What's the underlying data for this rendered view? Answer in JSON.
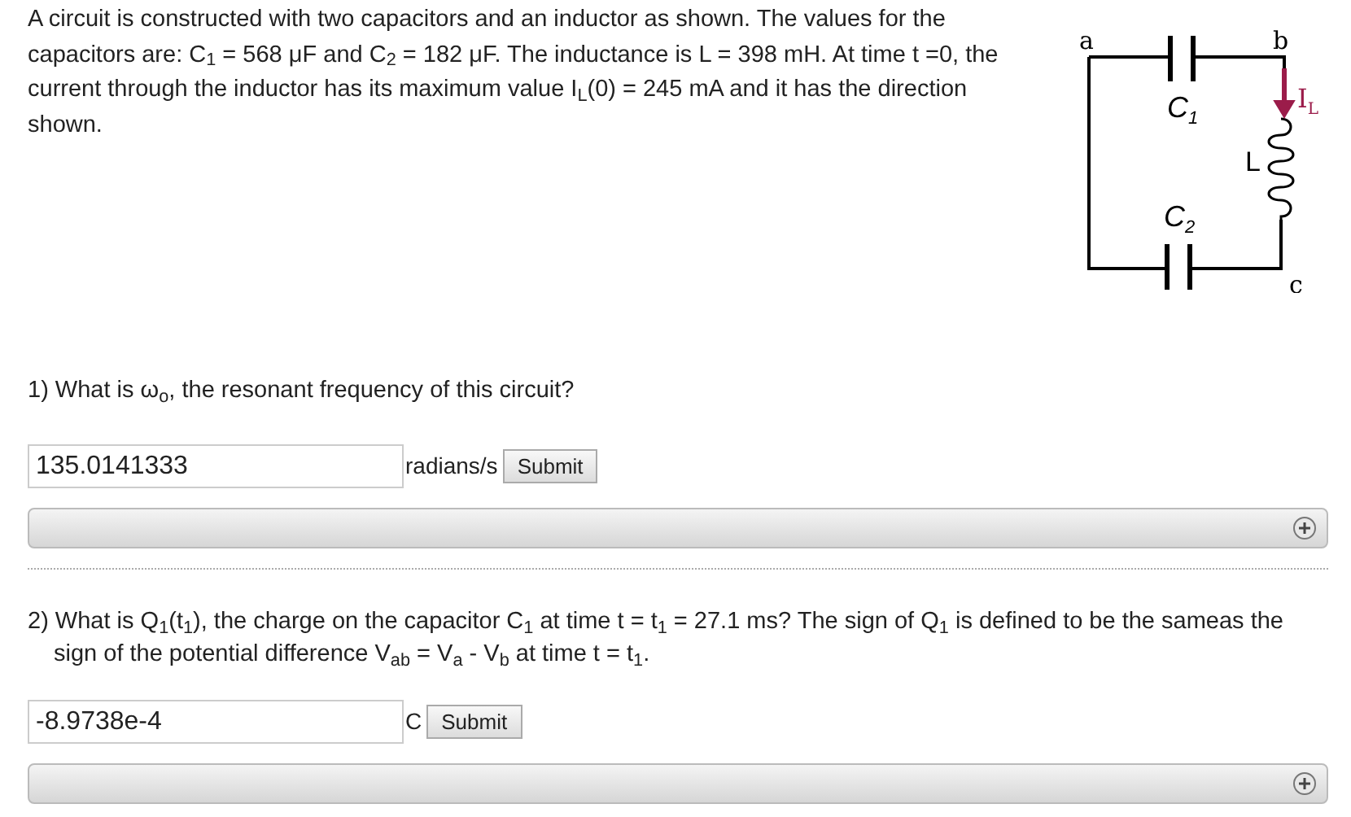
{
  "intro": "A circuit is constructed with two capacitors and an inductor as shown. The values for the capacitors are: C$_{1}$ = 568 μF and C$_{2}$ = 182 μF. The inductance is L = 398 mH. At time t =0, the current through the inductor has its maximum value I$_{L}$(0) = 245 mA and it has the direction shown.",
  "diagram": {
    "node_a": "a",
    "node_b": "b",
    "node_c": "c",
    "c1": "C",
    "c1_sub": "1",
    "c2": "C",
    "c2_sub": "2",
    "inductor": "L",
    "current": "I",
    "current_sub": "L"
  },
  "questions": [
    {
      "number": "1)",
      "text": "What is ω$_{o}$, the resonant frequency of this circuit?",
      "value": "135.0141333",
      "unit": "radians/s",
      "button": "Submit",
      "expanded": false
    },
    {
      "number": "2)",
      "text": "What is Q$_{1}$(t$_{1}$), the charge on the capacitor C$_{1}$ at time t = t$_{1}$ = 27.1 ms? The sign of Q$_{1}$ is defined to be the sameas the sign of the potential difference V$_{ab}$ = V$_{a}$ - V$_{b}$ at time t = t$_{1}$.",
      "value": "-8.9738e-4",
      "unit": "C",
      "button": "Submit",
      "expanded": false
    }
  ]
}
